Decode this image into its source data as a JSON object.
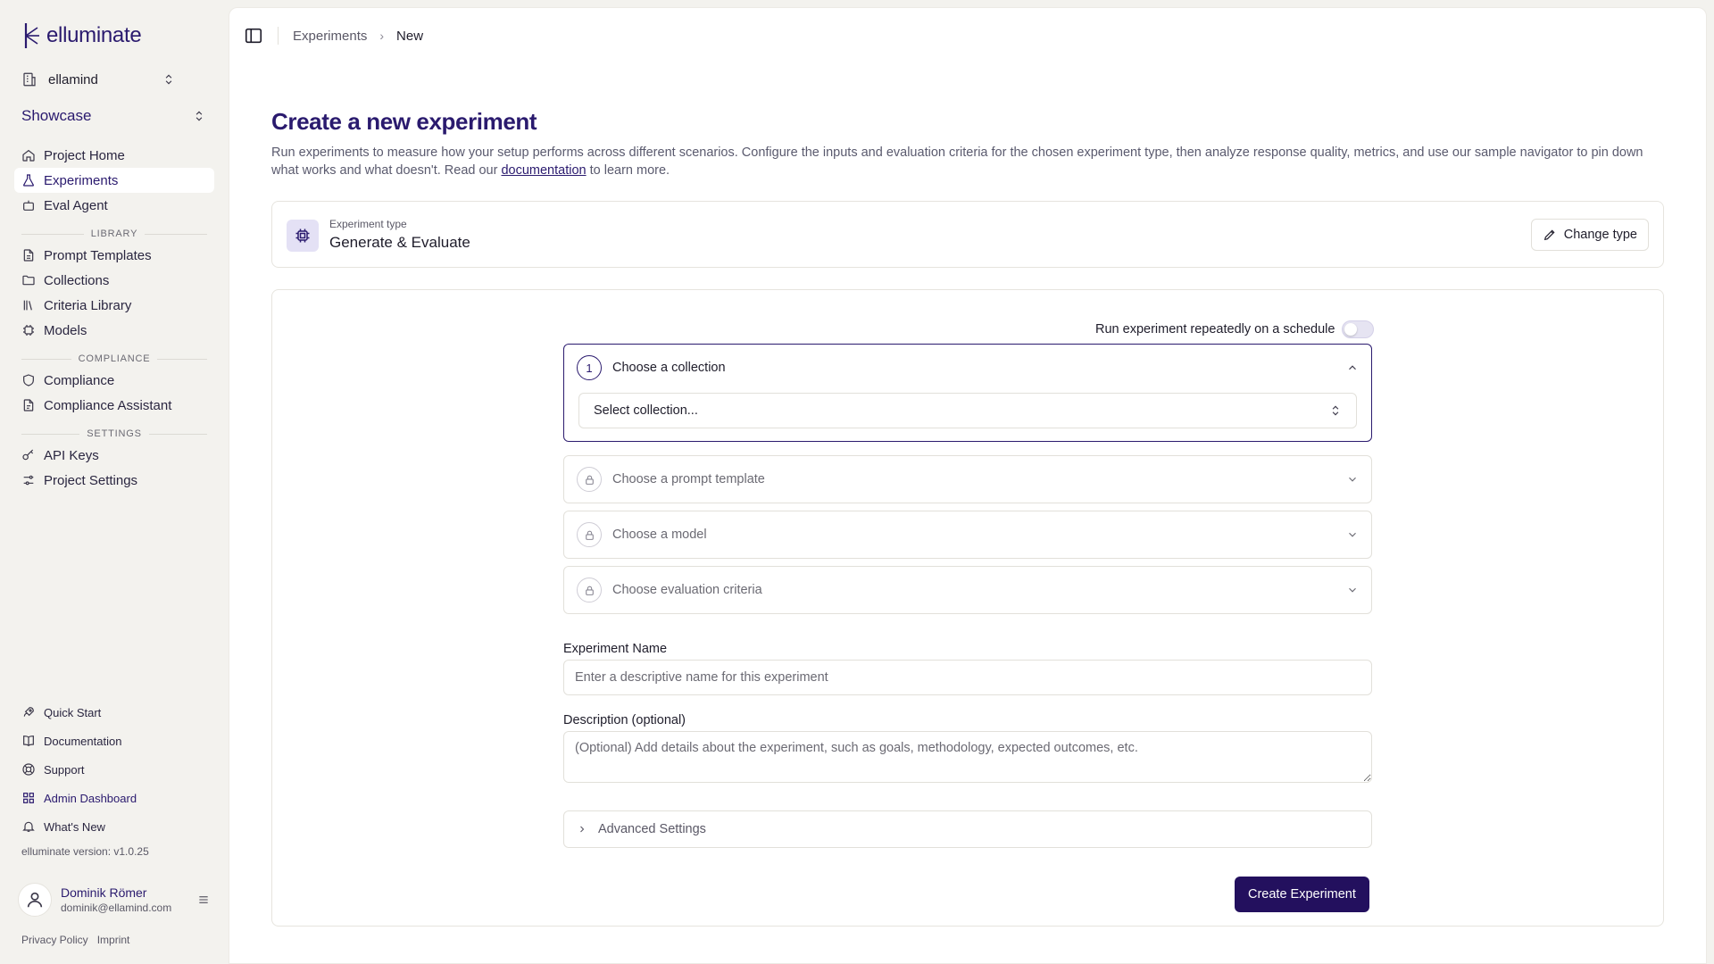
{
  "app": {
    "name": "elluminate"
  },
  "org": {
    "name": "ellamind"
  },
  "project": {
    "name": "Showcase"
  },
  "sidebar": {
    "main": [
      {
        "label": "Project Home",
        "icon": "home-icon"
      },
      {
        "label": "Experiments",
        "icon": "flask-icon",
        "active": true
      },
      {
        "label": "Eval Agent",
        "icon": "robot-icon"
      }
    ],
    "library_label": "LIBRARY",
    "library": [
      {
        "label": "Prompt Templates",
        "icon": "file-icon"
      },
      {
        "label": "Collections",
        "icon": "folder-icon"
      },
      {
        "label": "Criteria Library",
        "icon": "library-icon"
      },
      {
        "label": "Models",
        "icon": "chip-icon"
      }
    ],
    "compliance_label": "COMPLIANCE",
    "compliance": [
      {
        "label": "Compliance",
        "icon": "shield-icon"
      },
      {
        "label": "Compliance Assistant",
        "icon": "document-icon"
      }
    ],
    "settings_label": "SETTINGS",
    "settings": [
      {
        "label": "API Keys",
        "icon": "key-icon"
      },
      {
        "label": "Project Settings",
        "icon": "sliders-icon"
      }
    ],
    "bottom": [
      {
        "label": "Quick Start",
        "icon": "rocket-icon"
      },
      {
        "label": "Documentation",
        "icon": "book-icon"
      },
      {
        "label": "Support",
        "icon": "lifebuoy-icon"
      },
      {
        "label": "Admin Dashboard",
        "icon": "grid-icon"
      },
      {
        "label": "What's New",
        "icon": "bell-icon"
      }
    ],
    "version": "elluminate version: v1.0.25",
    "user": {
      "name": "Dominik Römer",
      "email": "dominik@ellamind.com"
    },
    "legal": {
      "privacy": "Privacy Policy",
      "imprint": "Imprint"
    }
  },
  "breadcrumb": {
    "parent": "Experiments",
    "current": "New"
  },
  "page": {
    "title": "Create a new experiment",
    "desc_before": "Run experiments to measure how your setup performs across different scenarios. Configure the inputs and evaluation criteria for the chosen experiment type, then analyze response quality, metrics, and use our sample navigator to pin down what works and what doesn't. Read our ",
    "desc_link": "documentation",
    "desc_after": " to learn more."
  },
  "experiment_type": {
    "label": "Experiment type",
    "value": "Generate & Evaluate",
    "change_label": "Change type"
  },
  "form": {
    "schedule_label": "Run experiment repeatedly on a schedule",
    "schedule_enabled": false,
    "steps": [
      {
        "number": "1",
        "title": "Choose a collection",
        "open": true,
        "select_placeholder": "Select collection..."
      },
      {
        "title": "Choose a prompt template",
        "locked": true
      },
      {
        "title": "Choose a model",
        "locked": true
      },
      {
        "title": "Choose evaluation criteria",
        "locked": true
      }
    ],
    "name_label": "Experiment Name",
    "name_placeholder": "Enter a descriptive name for this experiment",
    "desc_label": "Description (optional)",
    "desc_placeholder": "(Optional) Add details about the experiment, such as goals, methodology, expected outcomes, etc.",
    "advanced_label": "Advanced Settings",
    "create_label": "Create Experiment"
  },
  "colors": {
    "brand": "#2a1a6e",
    "primary_button": "#23105e",
    "background": "#f3f2ee"
  }
}
